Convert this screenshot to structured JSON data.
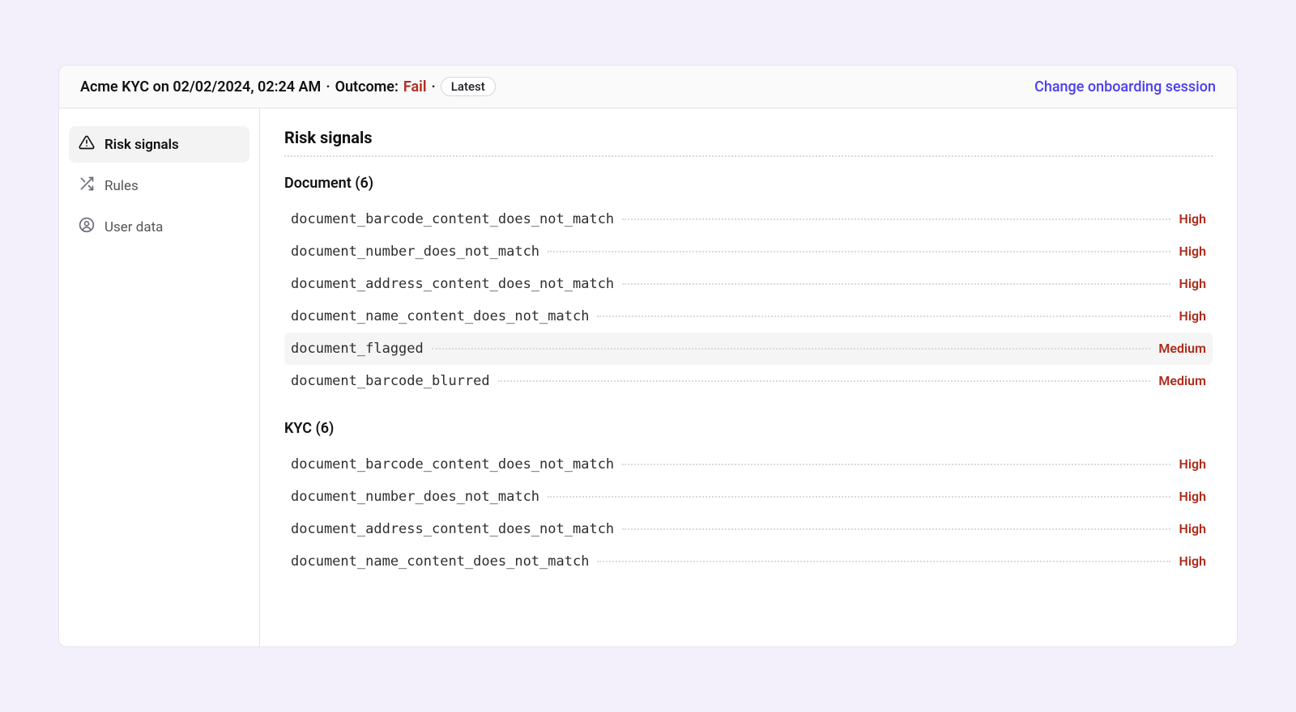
{
  "header": {
    "title": "Acme KYC on 02/02/2024, 02:24 AM",
    "outcome_label": "Outcome:",
    "outcome_value": "Fail",
    "badge": "Latest",
    "change_link": "Change onboarding session"
  },
  "sidebar": {
    "items": [
      {
        "label": "Risk signals",
        "id": "risk-signals"
      },
      {
        "label": "Rules",
        "id": "rules"
      },
      {
        "label": "User data",
        "id": "user-data"
      }
    ]
  },
  "main": {
    "title": "Risk signals",
    "groups": [
      {
        "label": "Document (6)",
        "signals": [
          {
            "name": "document_barcode_content_does_not_match",
            "severity": "High",
            "highlighted": false
          },
          {
            "name": "document_number_does_not_match",
            "severity": "High",
            "highlighted": false
          },
          {
            "name": "document_address_content_does_not_match",
            "severity": "High",
            "highlighted": false
          },
          {
            "name": "document_name_content_does_not_match",
            "severity": "High",
            "highlighted": false
          },
          {
            "name": "document_flagged",
            "severity": "Medium",
            "highlighted": true
          },
          {
            "name": "document_barcode_blurred",
            "severity": "Medium",
            "highlighted": false
          }
        ]
      },
      {
        "label": "KYC (6)",
        "signals": [
          {
            "name": "document_barcode_content_does_not_match",
            "severity": "High",
            "highlighted": false
          },
          {
            "name": "document_number_does_not_match",
            "severity": "High",
            "highlighted": false
          },
          {
            "name": "document_address_content_does_not_match",
            "severity": "High",
            "highlighted": false
          },
          {
            "name": "document_name_content_does_not_match",
            "severity": "High",
            "highlighted": false
          }
        ]
      }
    ]
  }
}
